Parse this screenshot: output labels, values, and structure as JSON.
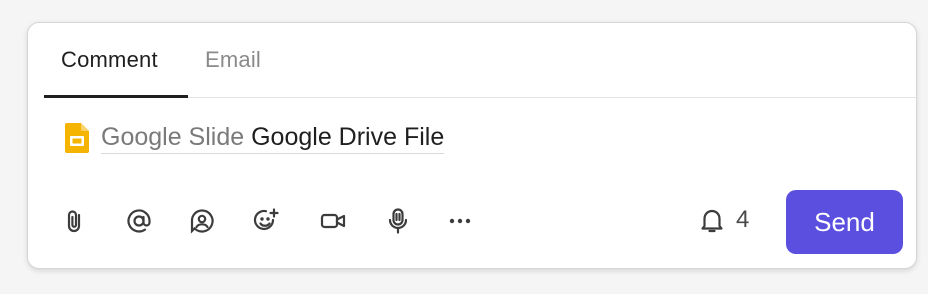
{
  "tabs": [
    {
      "label": "Comment",
      "active": true
    },
    {
      "label": "Email",
      "active": false
    }
  ],
  "attachment": {
    "type_label": "Google Slide",
    "name": "Google Drive File",
    "icon": "google-slides-icon"
  },
  "toolbar": {
    "icons": [
      "paperclip-icon",
      "at-mention-icon",
      "assign-icon",
      "emoji-add-icon",
      "video-icon",
      "microphone-icon",
      "more-icon"
    ]
  },
  "notifications": {
    "count": "4",
    "icon": "bell-icon"
  },
  "send": {
    "label": "Send"
  },
  "colors": {
    "accent": "#5b4fe0",
    "slide_icon": "#f4b400"
  }
}
